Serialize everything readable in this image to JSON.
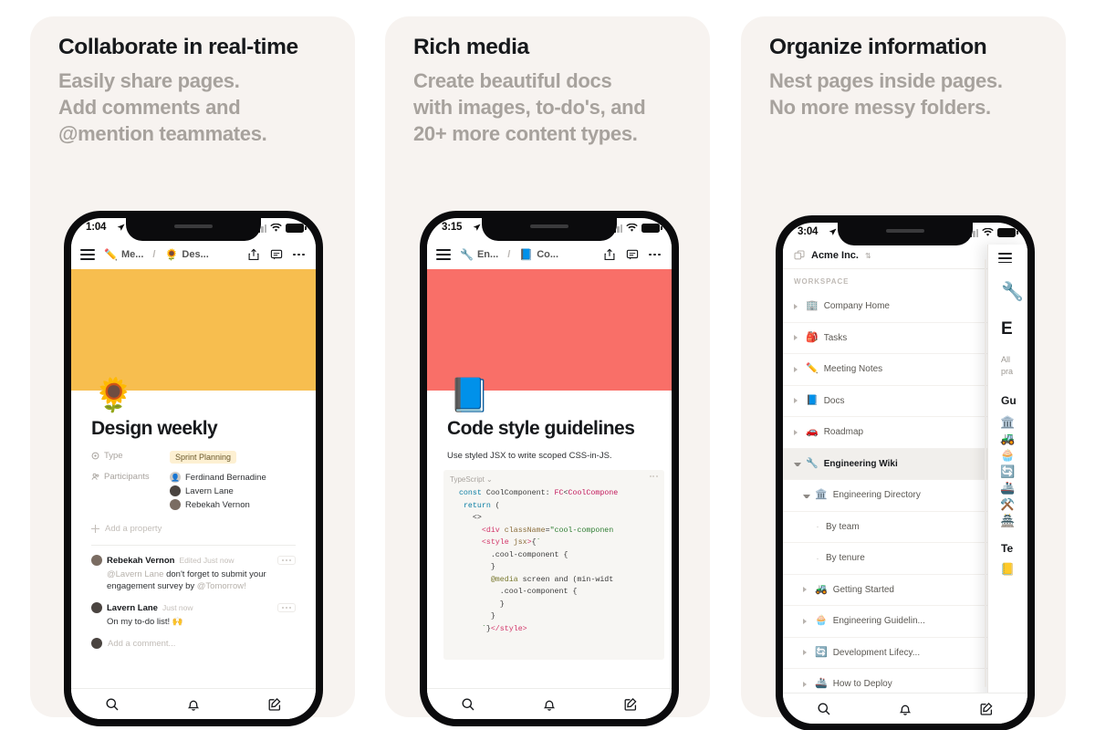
{
  "theme": {
    "page_bg": "#ffffff",
    "card_bg": "#f7f3f0",
    "title_color": "#17191c",
    "sub_color": "#a7a29d",
    "cover_yellow": "#f7be4f",
    "cover_red": "#f96f68",
    "tag_bg": "#fdf0d2"
  },
  "cards": [
    {
      "title": "Collaborate in real-time",
      "subtitle": "Easily share pages.\nAdd comments and\n@mention teammates."
    },
    {
      "title": "Rich media",
      "subtitle": "Create beautiful docs\nwith images, to-do's, and\n20+ more content types."
    },
    {
      "title": "Organize information",
      "subtitle": "Nest pages inside pages.\nNo more messy folders."
    }
  ],
  "phone1": {
    "status": {
      "time": "1:04",
      "location_icon": "location-arrow-icon"
    },
    "nav": {
      "menu_icon": "hamburger-menu-icon",
      "crumb1_emoji": "✏️",
      "crumb1": "Me...",
      "separator": "/",
      "crumb2_emoji": "🌻",
      "crumb2": "Des...",
      "share_icon": "share-icon",
      "comment_icon": "comment-icon",
      "more_icon": "more-options-icon"
    },
    "cover_color": "#f7be4f",
    "page_emoji": "🌻",
    "page_title": "Design weekly",
    "properties": [
      {
        "icon": "select-property-icon",
        "label": "Type",
        "kind": "tag",
        "value": "Sprint Planning"
      },
      {
        "icon": "person-property-icon",
        "label": "Participants",
        "kind": "people",
        "people": [
          "Ferdinand Bernadine",
          "Lavern Lane",
          "Rebekah Vernon"
        ]
      }
    ],
    "add_property": "Add a property",
    "comments": [
      {
        "author": "Rebekah Vernon",
        "meta": "Edited Just now",
        "mention": "@Lavern Lane",
        "text_before": " don't forget to submit your engagement survey by ",
        "date_mention": "@Tomorrow!"
      },
      {
        "author": "Lavern Lane",
        "meta": "Just now",
        "body": "On my to-do list! 🙌"
      }
    ],
    "add_comment_placeholder": "Add a comment...",
    "tabbar": [
      "search-icon",
      "notifications-bell-icon",
      "new-page-icon"
    ]
  },
  "phone2": {
    "status": {
      "time": "3:15",
      "location_icon": "location-arrow-icon"
    },
    "nav": {
      "menu_icon": "hamburger-menu-icon",
      "crumb1_emoji": "🔧",
      "crumb1": "En...",
      "separator": "/",
      "crumb2_emoji": "📘",
      "crumb2": "Co...",
      "share_icon": "share-icon",
      "comment_icon": "comment-icon",
      "more_icon": "more-options-icon"
    },
    "cover_color": "#f96f68",
    "page_emoji": "📘",
    "page_title": "Code style guidelines",
    "intro": "Use styled JSX to write scoped CSS-in-JS.",
    "code_lang": "TypeScript",
    "code_lang_chevron": "⌄",
    "code_more_icon": "code-more-icon",
    "code_lines": [
      "  const CoolComponent: FC<CoolCompone",
      "   return (",
      "     <>",
      "       <div className=\"cool-componen",
      "       <style jsx>{`",
      "         .cool-component {",
      "         }",
      "         @media screen and (min-widt",
      "           .cool-component {",
      "           }",
      "         }",
      "       `}</style>"
    ],
    "tabbar": [
      "search-icon",
      "notifications-bell-icon",
      "new-page-icon"
    ]
  },
  "phone3": {
    "status": {
      "time": "3:04",
      "location_icon": "location-arrow-icon"
    },
    "workspace": {
      "switcher_icon": "workspace-switcher-icon",
      "name": "Acme Inc.",
      "chevron": "⇅",
      "section_label": "WORKSPACE"
    },
    "tree": [
      {
        "emoji": "🏢",
        "label": "Company Home",
        "indent": 0,
        "state": "collapsed",
        "active": false
      },
      {
        "emoji": "🎒",
        "label": "Tasks",
        "indent": 0,
        "state": "collapsed",
        "active": false
      },
      {
        "emoji": "✏️",
        "label": "Meeting Notes",
        "indent": 0,
        "state": "collapsed",
        "active": false
      },
      {
        "emoji": "📘",
        "label": "Docs",
        "indent": 0,
        "state": "collapsed",
        "active": false
      },
      {
        "emoji": "🚗",
        "label": "Roadmap",
        "indent": 0,
        "state": "collapsed",
        "active": false
      },
      {
        "emoji": "🔧",
        "label": "Engineering Wiki",
        "indent": 0,
        "state": "expanded",
        "active": true
      },
      {
        "emoji": "🏛️",
        "label": "Engineering Directory",
        "indent": 1,
        "state": "expanded",
        "active": false
      },
      {
        "emoji": "",
        "label": "By team",
        "indent": 2,
        "state": "leaf",
        "active": false
      },
      {
        "emoji": "",
        "label": "By tenure",
        "indent": 2,
        "state": "leaf",
        "active": false
      },
      {
        "emoji": "🚜",
        "label": "Getting Started",
        "indent": 1,
        "state": "collapsed",
        "active": false
      },
      {
        "emoji": "🧁",
        "label": "Engineering Guidelin...",
        "indent": 1,
        "state": "collapsed",
        "active": false
      },
      {
        "emoji": "🔄",
        "label": "Development Lifecy...",
        "indent": 1,
        "state": "collapsed",
        "active": false
      },
      {
        "emoji": "🚢",
        "label": "How to Deploy",
        "indent": 1,
        "state": "collapsed",
        "active": false
      }
    ],
    "row_more_icon": "row-more-icon",
    "row_add_icon": "row-add-page-icon",
    "peek": {
      "menu_icon": "hamburger-menu-icon",
      "emoji": "🔧",
      "title": "E",
      "paragraph": "All\npra",
      "heading": "Gu",
      "list_emojis": [
        "🏛️",
        "🚜",
        "🧁",
        "🔄",
        "🚢",
        "⚒️",
        "🏯"
      ],
      "heading2": "Te",
      "last_emoji": "📒"
    },
    "tabbar": [
      "search-icon",
      "notifications-bell-icon",
      "new-page-icon"
    ]
  }
}
